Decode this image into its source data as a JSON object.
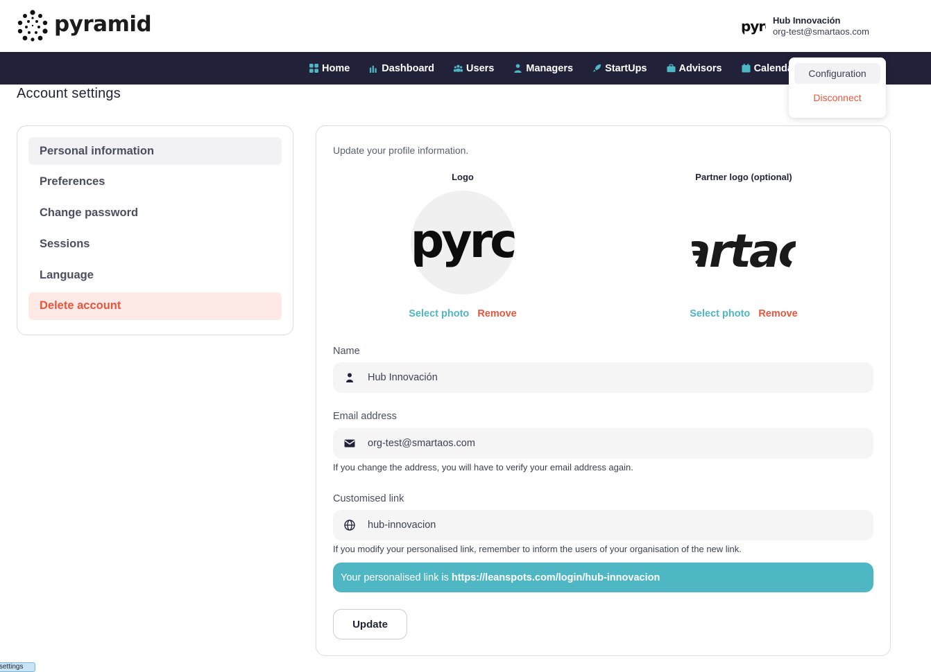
{
  "brand": {
    "name": "pyramid"
  },
  "user": {
    "name": "Hub Innovación",
    "email": "org-test@smartaos.com",
    "avatar_text": "pyrc"
  },
  "nav": {
    "items": [
      {
        "label": "Home",
        "icon": "grid-icon"
      },
      {
        "label": "Dashboard",
        "icon": "bar-chart-icon"
      },
      {
        "label": "Users",
        "icon": "users-icon"
      },
      {
        "label": "Managers",
        "icon": "user-tie-icon"
      },
      {
        "label": "StartUps",
        "icon": "rocket-icon"
      },
      {
        "label": "Advisors",
        "icon": "briefcase-icon"
      },
      {
        "label": "Calendar",
        "icon": "calendar-icon"
      }
    ]
  },
  "dropdown": {
    "configuration": "Configuration",
    "disconnect": "Disconnect"
  },
  "page": {
    "title": "Account settings"
  },
  "sidebar": {
    "items": [
      {
        "label": "Personal information"
      },
      {
        "label": "Preferences"
      },
      {
        "label": "Change password"
      },
      {
        "label": "Sessions"
      },
      {
        "label": "Language"
      },
      {
        "label": "Delete account"
      }
    ]
  },
  "form": {
    "intro": "Update your profile information.",
    "logo": {
      "label": "Logo",
      "image_text": "pyrc",
      "select": "Select photo",
      "remove": "Remove"
    },
    "partner_logo": {
      "label": "Partner logo (optional)",
      "image_text": "artac",
      "select": "Select photo",
      "remove": "Remove"
    },
    "name": {
      "label": "Name",
      "value": "Hub Innovación"
    },
    "email": {
      "label": "Email address",
      "value": "org-test@smartaos.com",
      "help": "If you change the address, you will have to verify your email address again."
    },
    "link": {
      "label": "Customised link",
      "value": "hub-innovacion",
      "help": "If you modify your personalised link, remember to inform the users of your organisation of the new link."
    },
    "banner": {
      "prefix": "Your personalised link is",
      "url": "https://leanspots.com/login/hub-innovacion"
    },
    "update_label": "Update"
  },
  "footer_tag": "settings",
  "colors": {
    "accent": "#4fb6c3",
    "danger": "#e8553b",
    "navbar": "#21223a"
  }
}
